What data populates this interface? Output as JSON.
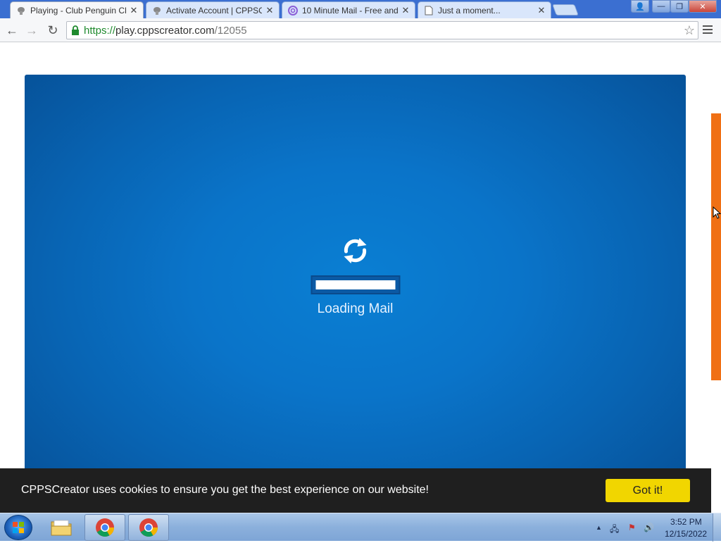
{
  "browser": {
    "tabs": [
      {
        "title": "Playing - Club Penguin Cl",
        "icon": "penguin-favicon-icon",
        "close": "✕",
        "active": true
      },
      {
        "title": "Activate Account | CPPSC",
        "icon": "penguin-favicon-icon",
        "close": "✕",
        "active": false
      },
      {
        "title": "10 Minute Mail - Free and",
        "icon": "at-sign-icon",
        "close": "✕",
        "active": false
      },
      {
        "title": "Just a moment...",
        "icon": "document-icon",
        "close": "✕",
        "active": false
      }
    ],
    "window_controls": {
      "user": "👤",
      "minimize": "—",
      "restore": "❐",
      "close": "✕"
    },
    "nav": {
      "back": "←",
      "forward": "→",
      "reload": "↻",
      "star": "☆"
    },
    "url": {
      "scheme": "https://",
      "host": "play.cppscreator.com",
      "path": "/12055"
    }
  },
  "page": {
    "loading_text": "Loading Mail",
    "progress": 1.0,
    "panel_color": "#0a74c9",
    "side_tab_color": "#f07015"
  },
  "cookie_banner": {
    "message": "CPPSCreator uses cookies to ensure you get the best experience on our website!",
    "button_label": "Got it!",
    "button_color": "#f1d600"
  },
  "taskbar": {
    "items": [
      "start-button",
      "file-explorer-icon",
      "chrome-icon",
      "chrome-icon"
    ],
    "tray": {
      "expand": "▲",
      "network": "🖧",
      "flag": "⚑",
      "volume": "🔊"
    },
    "clock": {
      "time": "3:52 PM",
      "date": "12/15/2022"
    }
  }
}
